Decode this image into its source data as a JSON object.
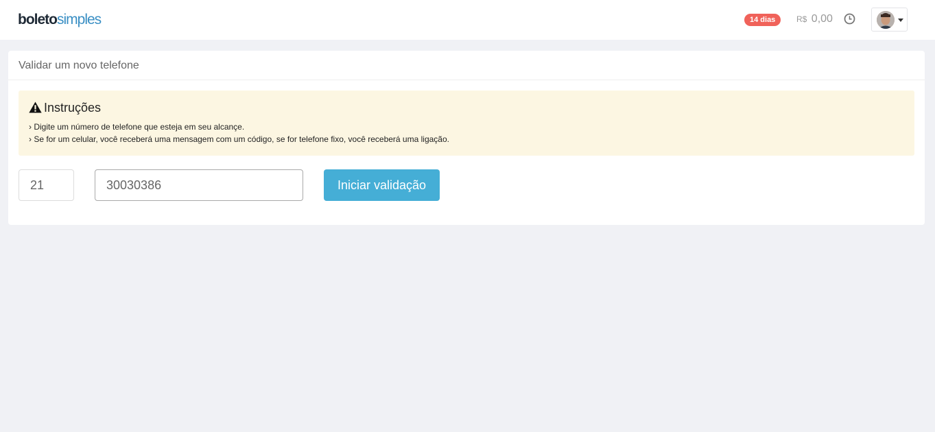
{
  "header": {
    "logo": {
      "part1": "boleto",
      "part2": "simples"
    },
    "trial_badge": "14 dias",
    "balance": {
      "currency": "R$",
      "amount": "0,00"
    },
    "icons": {
      "history": "clock-icon",
      "user_menu": "caret-down-icon"
    }
  },
  "panel": {
    "title": "Validar um novo telefone",
    "alert": {
      "icon": "warning-icon",
      "title": "Instruções",
      "lines": [
        "› Digite um número de telefone que esteja em seu alcançe.",
        "› Se for um celular, você receberá uma mensagem com um código, se for telefone fixo, você receberá uma ligação."
      ]
    },
    "form": {
      "ddd_value": "21",
      "phone_value": "30030386",
      "submit_label": "Iniciar validação"
    }
  },
  "colors": {
    "accent": "#45aed6",
    "badge": "#f0625a",
    "alert_bg": "#fcf6e2",
    "page_bg": "#f0f1f5"
  }
}
